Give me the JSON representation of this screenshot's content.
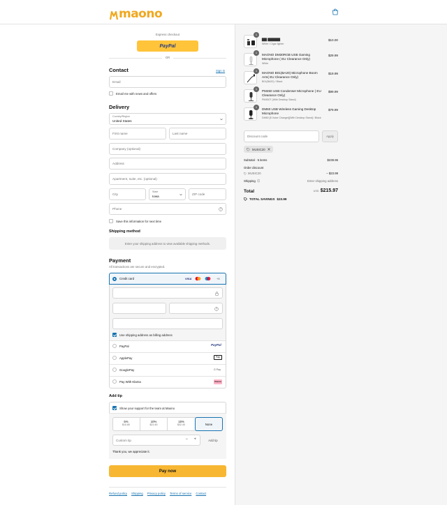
{
  "brand": {
    "name": "maono",
    "color": "#f0a81f"
  },
  "header": {
    "cart_icon": "shopping-bag-icon"
  },
  "express": {
    "label": "Express checkout",
    "paypal_label": "PayPal",
    "divider": "OR"
  },
  "contact": {
    "title": "Contact",
    "sign_in": "Sign in",
    "email_placeholder": "Email",
    "newsletter_label": "Email me with news and offers"
  },
  "delivery": {
    "title": "Delivery",
    "country_label": "Country/Region",
    "country_value": "United States",
    "first_name": "First name",
    "last_name": "Last name",
    "company": "Company (optional)",
    "address": "Address",
    "apartment": "Apartment, suite, etc. (optional)",
    "city": "City",
    "state_label": "State",
    "state_value": "Iowa",
    "zip": "ZIP code",
    "phone": "Phone",
    "save_info": "Save this information for next time"
  },
  "shipping": {
    "title": "Shipping method",
    "notice": "Enter your shipping address to view available shipping methods."
  },
  "payment": {
    "title": "Payment",
    "subtitle": "All transactions are secure and encrypted.",
    "credit_card_label": "Credit card",
    "card_brands": [
      "VISA",
      "+5"
    ],
    "billing_same": "Use shipping address as billing address",
    "methods": [
      {
        "label": "PayPal",
        "badge": "PayPal"
      },
      {
        "label": "ApplePay",
        "badge": "Pay"
      },
      {
        "label": "GooglePay",
        "badge": "G Pay"
      },
      {
        "label": "Pay With Klarna",
        "badge": "Klarna"
      }
    ]
  },
  "tip": {
    "title": "Add tip",
    "support_label": "Show your support for the team at Maono",
    "options": [
      {
        "pct": "5%",
        "amount": "$10.80"
      },
      {
        "pct": "10%",
        "amount": "$21.60"
      },
      {
        "pct": "15%",
        "amount": "$32.40"
      },
      {
        "pct": "None",
        "amount": ""
      }
    ],
    "custom_placeholder": "Custom tip",
    "add_label": "Add tip",
    "thanks": "Thank you, we appreciate it."
  },
  "pay_now": "Pay now",
  "footer_links": [
    "Refund policy",
    "Shipping",
    "Privacy policy",
    "Terms of service",
    "Contact"
  ],
  "cart": {
    "items": [
      {
        "qty": "1",
        "name": "▇▇ ▇▇▇▇▇",
        "variant": "White / Cigar lighter",
        "price": "$10.00"
      },
      {
        "qty": "1",
        "name": "MAONO DM30RGB USB Gaming Microphone ( EU Clearance Only)",
        "variant": "White",
        "price": "$29.99"
      },
      {
        "qty": "1",
        "name": "MAONO B01(BA20) Microphone Boom Arm( EU Clearance Only)",
        "variant": "B01(BA20) / Black",
        "price": "$19.99"
      },
      {
        "qty": "1",
        "name": "PM450 USB Condenser Microphone ( EU Clearance Only)",
        "variant": "PM450T (With Desktop Stand)",
        "price": "$99.99"
      },
      {
        "qty": "1",
        "name": "DM60 USB Wireless Gaming Desktop Microphone",
        "variant": "DM60 [8 Voice Changer][With Desktop Stand] / Black",
        "price": "$79.99"
      }
    ],
    "discount_placeholder": "Discount code",
    "apply_label": "Apply",
    "discount_tag": "MUSIC20",
    "subtotal_label": "Subtotal · 5 items",
    "subtotal_value": "$239.96",
    "order_discount_label": "Order discount",
    "discount_code": "MUSIC20",
    "discount_value": "– $23.99",
    "shipping_label": "Shipping",
    "shipping_value": "Enter shipping address",
    "total_label": "Total",
    "currency": "USD",
    "total_value": "$215.97",
    "savings_label": "TOTAL SAVINGS",
    "savings_value": "$23.99"
  },
  "colors": {
    "accent": "#1773b0",
    "pay_button": "#f7b733",
    "paypal": "#ffc43a"
  }
}
